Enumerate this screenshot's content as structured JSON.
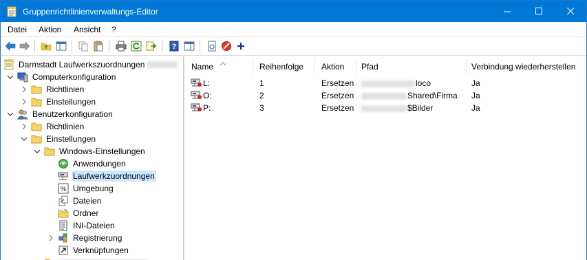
{
  "window": {
    "title": "Gruppenrichtlinienverwaltungs-Editor"
  },
  "menu": [
    "Datei",
    "Aktion",
    "Ansicht",
    "?"
  ],
  "toolbar": {
    "buttons": [
      "back-icon",
      "forward-icon",
      "up-folder-icon",
      "show-hide-tree-icon",
      "copy-icon",
      "paste-icon",
      "print-icon",
      "refresh-icon",
      "export-icon",
      "help-icon",
      "show-action-pane-icon",
      "properties-icon",
      "stop-icon",
      "add-icon"
    ]
  },
  "tree": {
    "root": "Darmstadt Laufwerkszuordnungen",
    "items": [
      {
        "label": "Computerkonfiguration"
      },
      {
        "label": "Richtlinien"
      },
      {
        "label": "Einstellungen"
      },
      {
        "label": "Benutzerkonfiguration"
      },
      {
        "label": "Richtlinien"
      },
      {
        "label": "Einstellungen"
      },
      {
        "label": "Windows-Einstellungen"
      },
      {
        "label": "Anwendungen"
      },
      {
        "label": "Laufwerkzuordnungen"
      },
      {
        "label": "Umgebung"
      },
      {
        "label": "Dateien"
      },
      {
        "label": "Ordner"
      },
      {
        "label": "INI-Dateien"
      },
      {
        "label": "Registrierung"
      },
      {
        "label": "Verknüpfungen"
      }
    ]
  },
  "list": {
    "columns": [
      "Name",
      "Reihenfolge",
      "Aktion",
      "Pfad",
      "Verbindung wiederherstellen"
    ],
    "rows": [
      {
        "name": "L:",
        "order": "1",
        "action": "Ersetzen",
        "path_suffix": "loco",
        "reconnect": "Ja"
      },
      {
        "name": "O:",
        "order": "2",
        "action": "Ersetzen",
        "path_suffix": "Shared\\Firma",
        "reconnect": "Ja"
      },
      {
        "name": "P:",
        "order": "3",
        "action": "Ersetzen",
        "path_suffix": "$Bilder",
        "reconnect": "Ja"
      }
    ]
  },
  "colors": {
    "titlebar": "#0078d7",
    "selection": "#cce8ff"
  }
}
